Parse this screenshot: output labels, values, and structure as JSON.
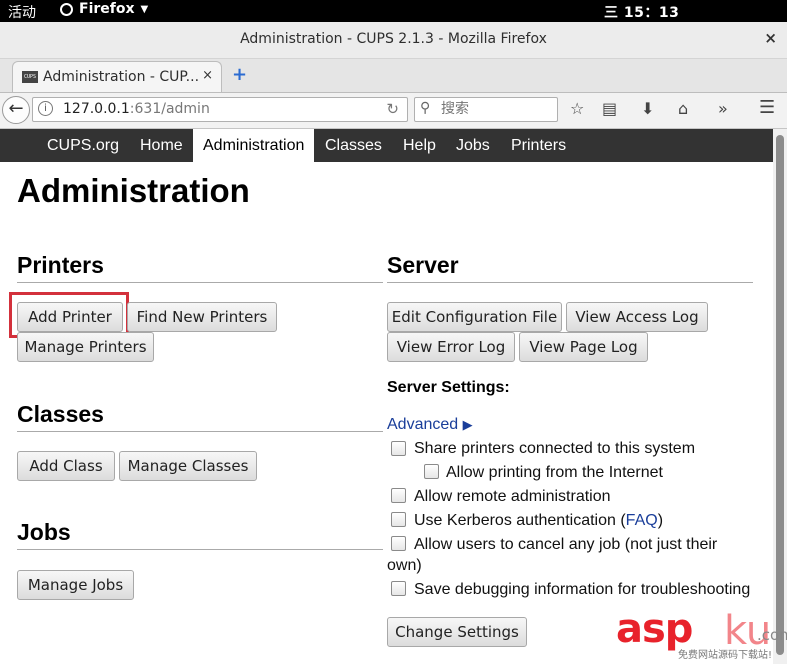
{
  "system": {
    "activities": "活动",
    "app_name": "Firefox",
    "clock": "三 15：13"
  },
  "window": {
    "title": "Administration - CUPS 2.1.3 - Mozilla Firefox",
    "close": "×"
  },
  "tab": {
    "favicon": "CUPS",
    "label": "Administration - CUP...",
    "close": "×",
    "new_tab": "+"
  },
  "navbar": {
    "url_host": "127.0.0.1",
    "url_path": ":631/admin",
    "search_placeholder": "搜索",
    "icons": [
      "back-icon",
      "info-icon",
      "reload-icon",
      "search-icon",
      "bookmark-star-icon",
      "reading-list-icon",
      "download-icon",
      "home-icon",
      "overflow-icon",
      "menu-icon"
    ]
  },
  "cups_nav": [
    "CUPS.org",
    "Home",
    "Administration",
    "Classes",
    "Help",
    "Jobs",
    "Printers"
  ],
  "page": {
    "title": "Administration",
    "printers": {
      "heading": "Printers",
      "add_printer": "Add Printer",
      "find_new": "Find New Printers",
      "manage": "Manage Printers"
    },
    "classes": {
      "heading": "Classes",
      "add_class": "Add Class",
      "manage": "Manage Classes"
    },
    "jobs": {
      "heading": "Jobs",
      "manage": "Manage Jobs"
    },
    "server": {
      "heading": "Server",
      "edit_config": "Edit Configuration File",
      "view_access_log": "View Access Log",
      "view_error_log": "View Error Log",
      "view_page_log": "View Page Log",
      "settings_heading": "Server Settings:",
      "advanced": "Advanced",
      "share_printers": "Share printers connected to this system",
      "allow_internet": "Allow printing from the Internet",
      "remote_admin": "Allow remote administration",
      "kerberos_pre": "Use Kerberos authentication (",
      "kerberos_link": "FAQ",
      "kerberos_post": ")",
      "cancel_jobs_line1": "Allow users to cancel any job (not just their",
      "cancel_jobs_line2": "own)",
      "debug_logging": "Save debugging information for troubleshooting",
      "change_settings": "Change Settings"
    }
  },
  "watermark": {
    "brand": "asp",
    "brand2": "ku",
    "tld": ".com",
    "tagline": "免费网站源码下载站!"
  },
  "colors": {
    "nav_bg": "#333333",
    "highlight_box": "#d3313c",
    "link": "#1a3e9a"
  }
}
